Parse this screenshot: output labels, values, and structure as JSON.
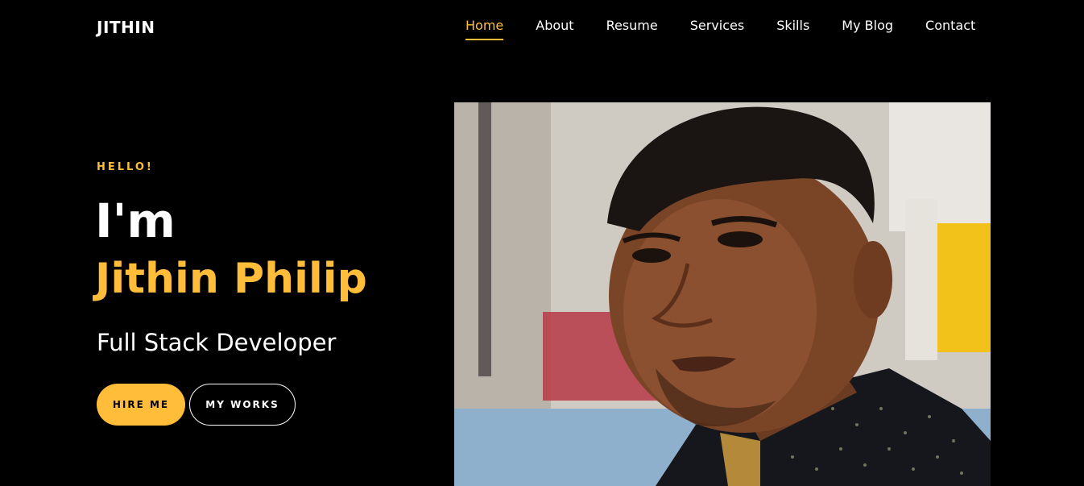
{
  "brand": "JITHIN",
  "nav": {
    "items": [
      {
        "label": "Home",
        "active": true
      },
      {
        "label": "About",
        "active": false
      },
      {
        "label": "Resume",
        "active": false
      },
      {
        "label": "Services",
        "active": false
      },
      {
        "label": "Skills",
        "active": false
      },
      {
        "label": "My Blog",
        "active": false
      },
      {
        "label": "Contact",
        "active": false
      }
    ]
  },
  "hero": {
    "greeting": "HELLO!",
    "intro": "I'm",
    "name": "Jithin Philip",
    "role": "Full Stack Developer",
    "hire_label": "HIRE ME",
    "works_label": "MY WORKS"
  },
  "colors": {
    "accent": "#ffbd39",
    "background": "#000000",
    "text": "#ffffff"
  }
}
